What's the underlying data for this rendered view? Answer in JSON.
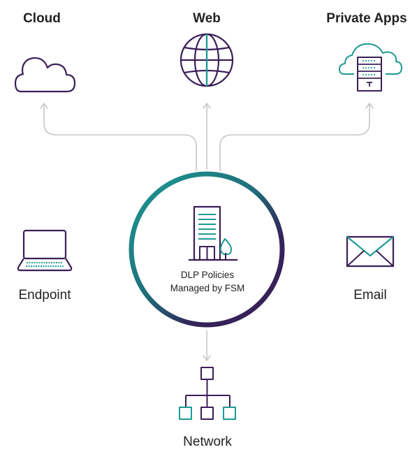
{
  "nodes": {
    "cloud": "Cloud",
    "web": "Web",
    "private_apps": "Private Apps",
    "endpoint": "Endpoint",
    "email": "Email",
    "network": "Network"
  },
  "center": {
    "line1": "DLP Policies",
    "line2": "Managed by FSM"
  },
  "colors": {
    "purple": "#3b1f57",
    "teal": "#1e9a94",
    "connector": "#c7c7c7"
  },
  "icons": {
    "cloud": "cloud-icon",
    "web": "globe-icon",
    "private_apps": "server-cloud-icon",
    "endpoint": "laptop-icon",
    "email": "envelope-icon",
    "network": "network-hierarchy-icon",
    "center": "office-building-icon"
  }
}
